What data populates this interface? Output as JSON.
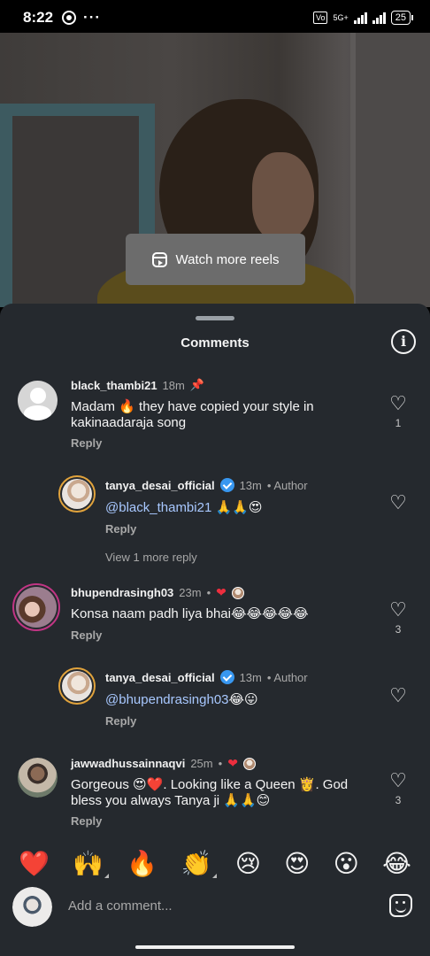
{
  "status_bar": {
    "time": "8:22",
    "dots": "···",
    "network": "5G+",
    "battery": "25"
  },
  "video": {
    "watch_more_label": "Watch more reels"
  },
  "sheet": {
    "title": "Comments"
  },
  "comments": [
    {
      "username": "black_thambi21",
      "time": "18m",
      "text": "Madam 🔥 they have copied your style in kakinaadaraja song",
      "reply_label": "Reply",
      "likes": "1"
    },
    {
      "username": "tanya_desai_official",
      "time": "13m",
      "author_label": "Author",
      "mention": "@black_thambi21",
      "text": " 🙏🙏😍",
      "reply_label": "Reply",
      "view_more": "View 1 more reply"
    },
    {
      "username": "bhupendrasingh03",
      "time": "23m",
      "text": "Konsa naam padh liya bhai😂😂😂😂😂",
      "reply_label": "Reply",
      "likes": "3"
    },
    {
      "username": "tanya_desai_official",
      "time": "13m",
      "author_label": "Author",
      "mention": "@bhupendrasingh03",
      "text": "😂😛",
      "reply_label": "Reply"
    },
    {
      "username": "jawwadhussainnaqvi",
      "time": "25m",
      "text": "Gorgeous 😍❤️. Looking like a Queen 👸. God bless you always Tanya ji 🙏🙏😊",
      "reply_label": "Reply",
      "likes": "3"
    }
  ],
  "reactions": [
    "❤️",
    "🙌",
    "🔥",
    "👏",
    "😢",
    "😍",
    "😮",
    "😂"
  ],
  "input": {
    "placeholder": "Add a comment..."
  }
}
